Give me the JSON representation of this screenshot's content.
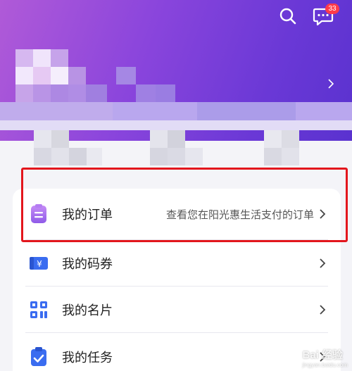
{
  "header": {
    "notification_badge": "33",
    "colors": {
      "gradient_start": "#b05ad8",
      "gradient_end": "#5a32cf"
    }
  },
  "menu": {
    "items": [
      {
        "label": "我的订单",
        "description": "查看您在阳光惠生活支付的订单",
        "icon": "order-clipboard-icon"
      },
      {
        "label": "我的码券",
        "description": "",
        "icon": "coupon-ticket-icon"
      },
      {
        "label": "我的名片",
        "description": "",
        "icon": "business-card-grid-icon"
      },
      {
        "label": "我的任务",
        "description": "",
        "icon": "task-clipboard-check-icon"
      }
    ]
  },
  "watermark": {
    "brand": "Bai 经验",
    "url": "jingyan.baidu.com"
  },
  "accent_colors": {
    "purple_icon": "#9a5ff0",
    "blue_icon": "#3a6cf0",
    "highlight_border": "#e3161d"
  }
}
